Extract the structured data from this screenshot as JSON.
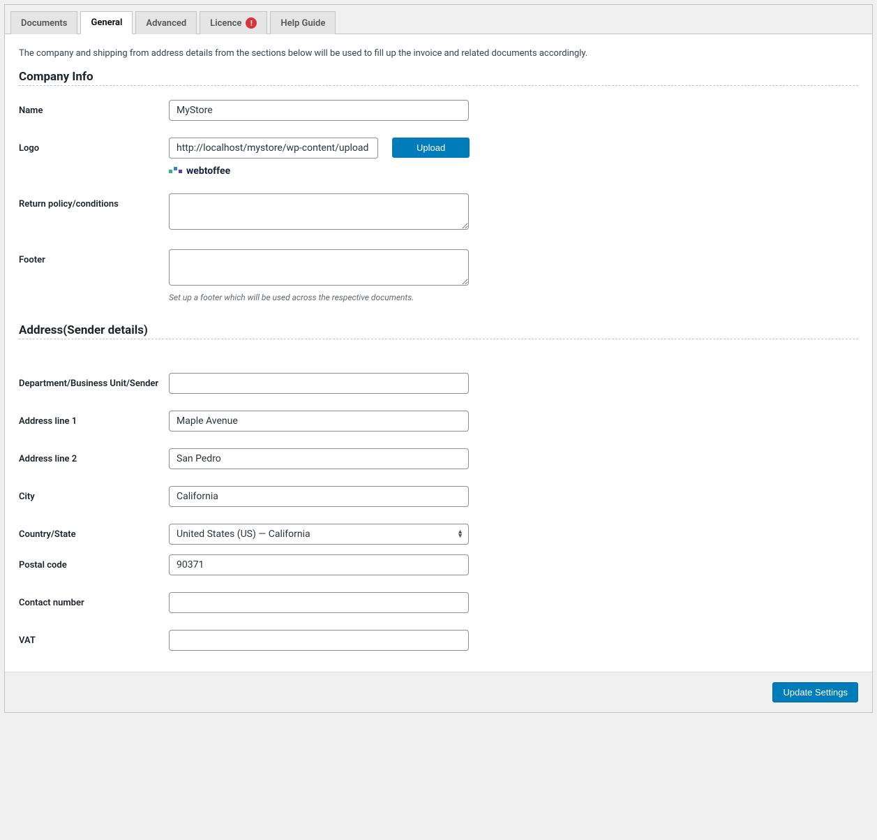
{
  "tabs": {
    "documents": "Documents",
    "general": "General",
    "advanced": "Advanced",
    "licence": "Licence",
    "licence_badge": "!",
    "help": "Help Guide"
  },
  "description": "The company and shipping from address details from the sections below will be used to fill up the invoice and related documents accordingly.",
  "company": {
    "title": "Company Info",
    "name_label": "Name",
    "name_value": "MyStore",
    "logo_label": "Logo",
    "logo_value": "http://localhost/mystore/wp-content/upload",
    "upload_button": "Upload",
    "logo_preview_text": "webtoffee",
    "return_label": "Return policy/conditions",
    "return_value": "",
    "footer_label": "Footer",
    "footer_value": "",
    "footer_help": "Set up a footer which will be used across the respective documents."
  },
  "address": {
    "title": "Address(Sender details)",
    "dept_label": "Department/Business Unit/Sender",
    "dept_value": "",
    "line1_label": "Address line 1",
    "line1_value": "Maple Avenue",
    "line2_label": "Address line 2",
    "line2_value": "San Pedro",
    "city_label": "City",
    "city_value": "California",
    "country_label": "Country/State",
    "country_value": "United States (US) — California",
    "postal_label": "Postal code",
    "postal_value": "90371",
    "contact_label": "Contact number",
    "contact_value": "",
    "vat_label": "VAT",
    "vat_value": ""
  },
  "footer": {
    "update_button": "Update Settings"
  }
}
